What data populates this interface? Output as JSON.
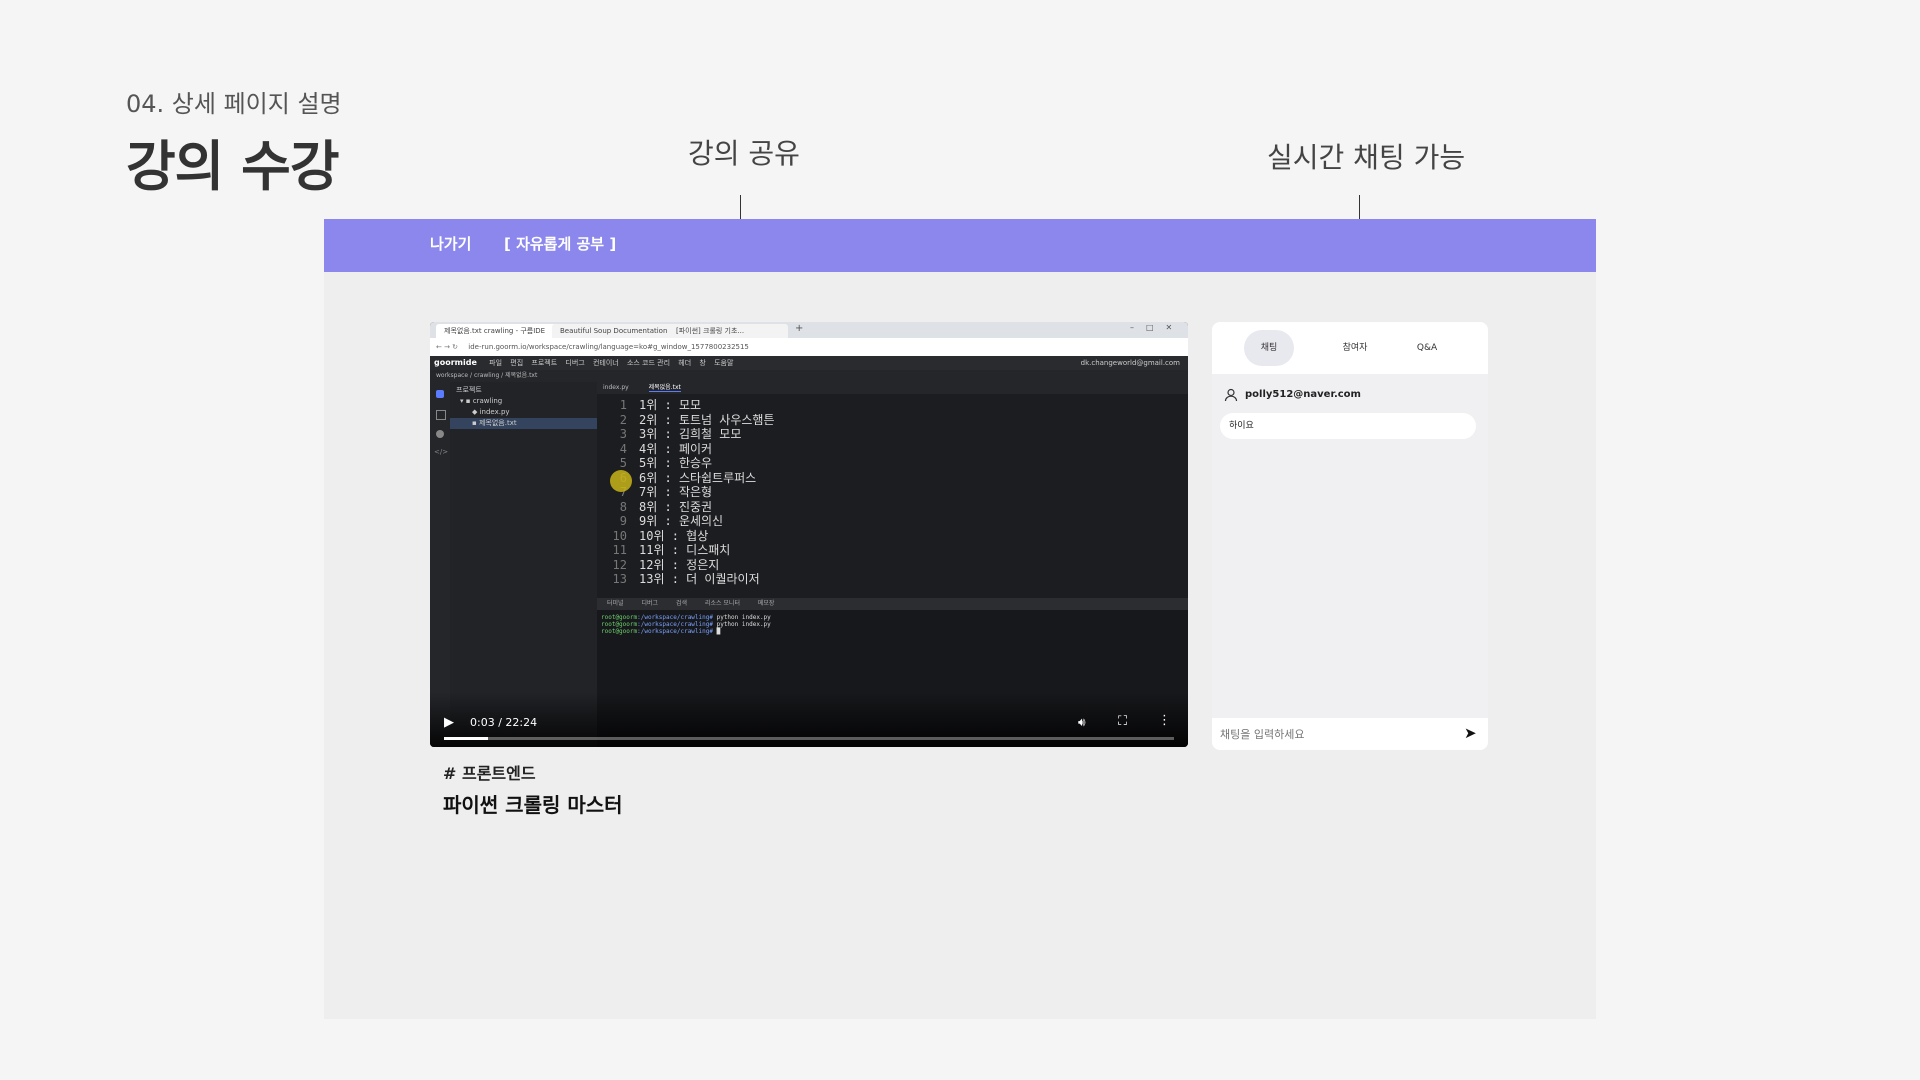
{
  "header": {
    "section_no": "04. 상세 페이지 설명",
    "title": "강의 수강"
  },
  "callouts": {
    "share": "강의 공유",
    "chat": "실시간 채팅 가능"
  },
  "topbar": {
    "exit_label": "나가기",
    "course_label": "[ 자유롭게 공부 ]",
    "color": "#8b87ec"
  },
  "video": {
    "browser_tabs": [
      "제목없음.txt crawling - 구름IDE",
      "Beautiful Soup Documentation",
      "[파이썬] 크롤링 기초..."
    ],
    "url": "ide-run.goorm.io/workspace/crawling/language=ko#g_window_1577800232515",
    "ide": {
      "logo": "goormide",
      "menu": [
        "파일",
        "편집",
        "프로젝트",
        "디버그",
        "컨테이너",
        "소스 코드 관리",
        "헤더",
        "창",
        "도움말"
      ],
      "account": "dk.changeworld@gmail.com",
      "breadcrumb": "workspace / crawling / 제목없음.txt",
      "explorer_title": "프로젝트",
      "tree": [
        "crawling",
        "index.py",
        "제목없음.txt"
      ],
      "editor_tabs": [
        "index.py",
        "제목없음.txt"
      ],
      "code_lines": [
        {
          "n": "1",
          "t": "1위 : 모모"
        },
        {
          "n": "2",
          "t": "2위 : 토트넘 사우스햄튼"
        },
        {
          "n": "3",
          "t": "3위 : 김희철 모모"
        },
        {
          "n": "4",
          "t": "4위 : 페이커"
        },
        {
          "n": "5",
          "t": "5위 : 한승우"
        },
        {
          "n": "6",
          "t": "6위 : 스타쉽트루퍼스"
        },
        {
          "n": "7",
          "t": "7위 : 작은형"
        },
        {
          "n": "8",
          "t": "8위 : 진중권"
        },
        {
          "n": "9",
          "t": "9위 : 운세의신"
        },
        {
          "n": "10",
          "t": "10위 : 협상"
        },
        {
          "n": "11",
          "t": "11위 : 디스패치"
        },
        {
          "n": "12",
          "t": "12위 : 정은지"
        },
        {
          "n": "13",
          "t": "13위 : 더 이퀄라이저"
        }
      ],
      "panel_tabs": [
        "터미널",
        "디버그",
        "검색",
        "리소스 모니터",
        "메모장"
      ],
      "terminal_lines": [
        {
          "prompt": "root@goorm",
          "path": ":/workspace/crawling#",
          "cmd": " python index.py"
        },
        {
          "prompt": "root@goorm",
          "path": ":/workspace/crawling#",
          "cmd": " python index.py"
        },
        {
          "prompt": "root@goorm",
          "path": ":/workspace/crawling#",
          "cmd": " "
        }
      ]
    },
    "time": "0:03 / 22:24",
    "progress": 0.0022
  },
  "chat": {
    "tabs": [
      "채팅",
      "참여자",
      "Q&A"
    ],
    "user": "polly512@naver.com",
    "message": "하이요",
    "input_placeholder": "채팅을 입력하세요"
  },
  "course": {
    "tag": "# 프론트엔드",
    "title": "파이썬 크롤링 마스터"
  }
}
